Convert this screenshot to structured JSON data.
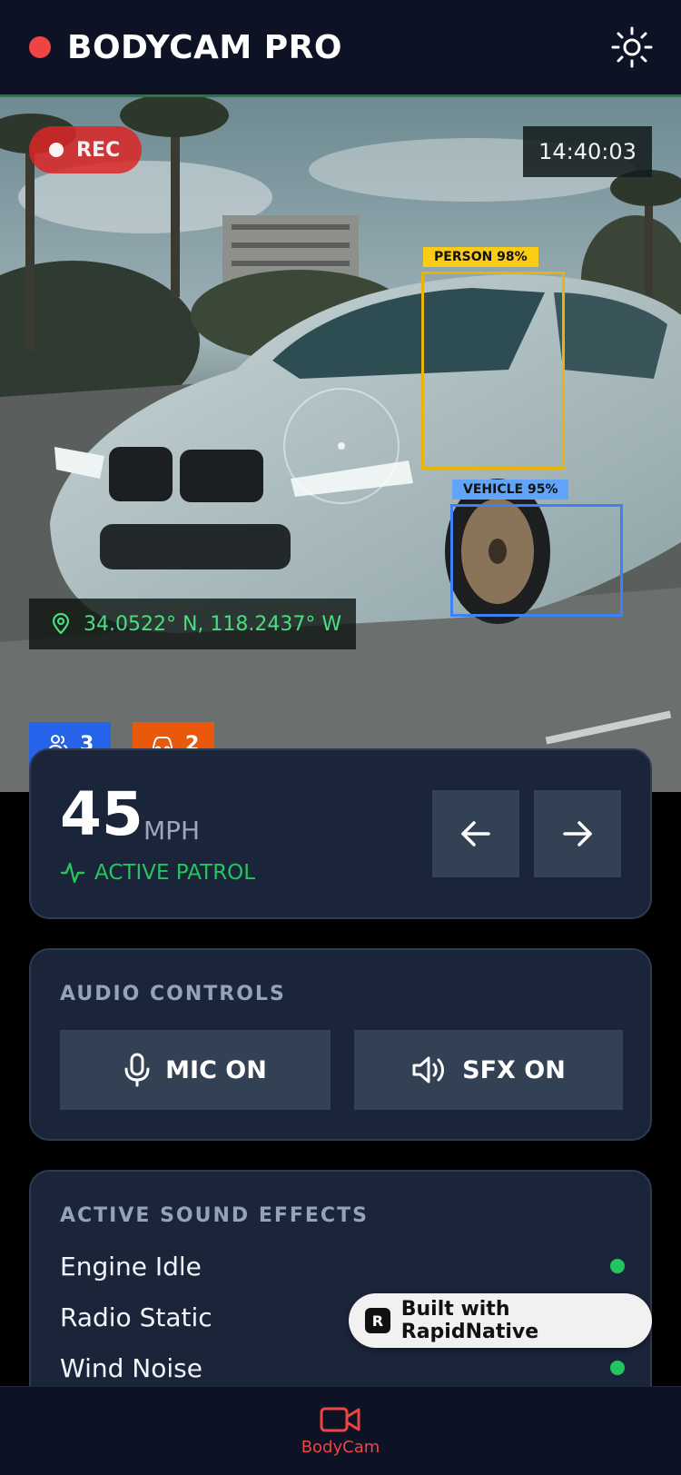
{
  "header": {
    "title": "BODYCAM PRO",
    "settings_icon": "sun-icon"
  },
  "feed": {
    "rec_label": "REC",
    "timestamp": "14:40:03",
    "detections": [
      {
        "label": "PERSON 98%",
        "color": "#facc15"
      },
      {
        "label": "VEHICLE 95%",
        "color": "#60a5fa"
      }
    ],
    "gps": "34.0522° N, 118.2437° W",
    "people_count": "3",
    "vehicle_count": "2"
  },
  "speed": {
    "value": "45",
    "unit": "MPH",
    "status": "ACTIVE PATROL"
  },
  "audio": {
    "title": "AUDIO CONTROLS",
    "mic_label": "MIC ON",
    "sfx_label": "SFX ON"
  },
  "sound_effects": {
    "title": "ACTIVE SOUND EFFECTS",
    "items": [
      {
        "name": "Engine Idle",
        "active": true
      },
      {
        "name": "Radio Static",
        "active": true
      },
      {
        "name": "Wind Noise",
        "active": true
      }
    ]
  },
  "badge": {
    "text": "Built with RapidNative"
  },
  "bottom_nav": {
    "items": [
      {
        "label": "BodyCam",
        "icon": "video-camera-icon",
        "active": true
      }
    ]
  },
  "colors": {
    "accent_red": "#ef4444",
    "accent_green": "#22c55e",
    "card_bg": "#1b253a",
    "header_bg": "#0d1324"
  }
}
